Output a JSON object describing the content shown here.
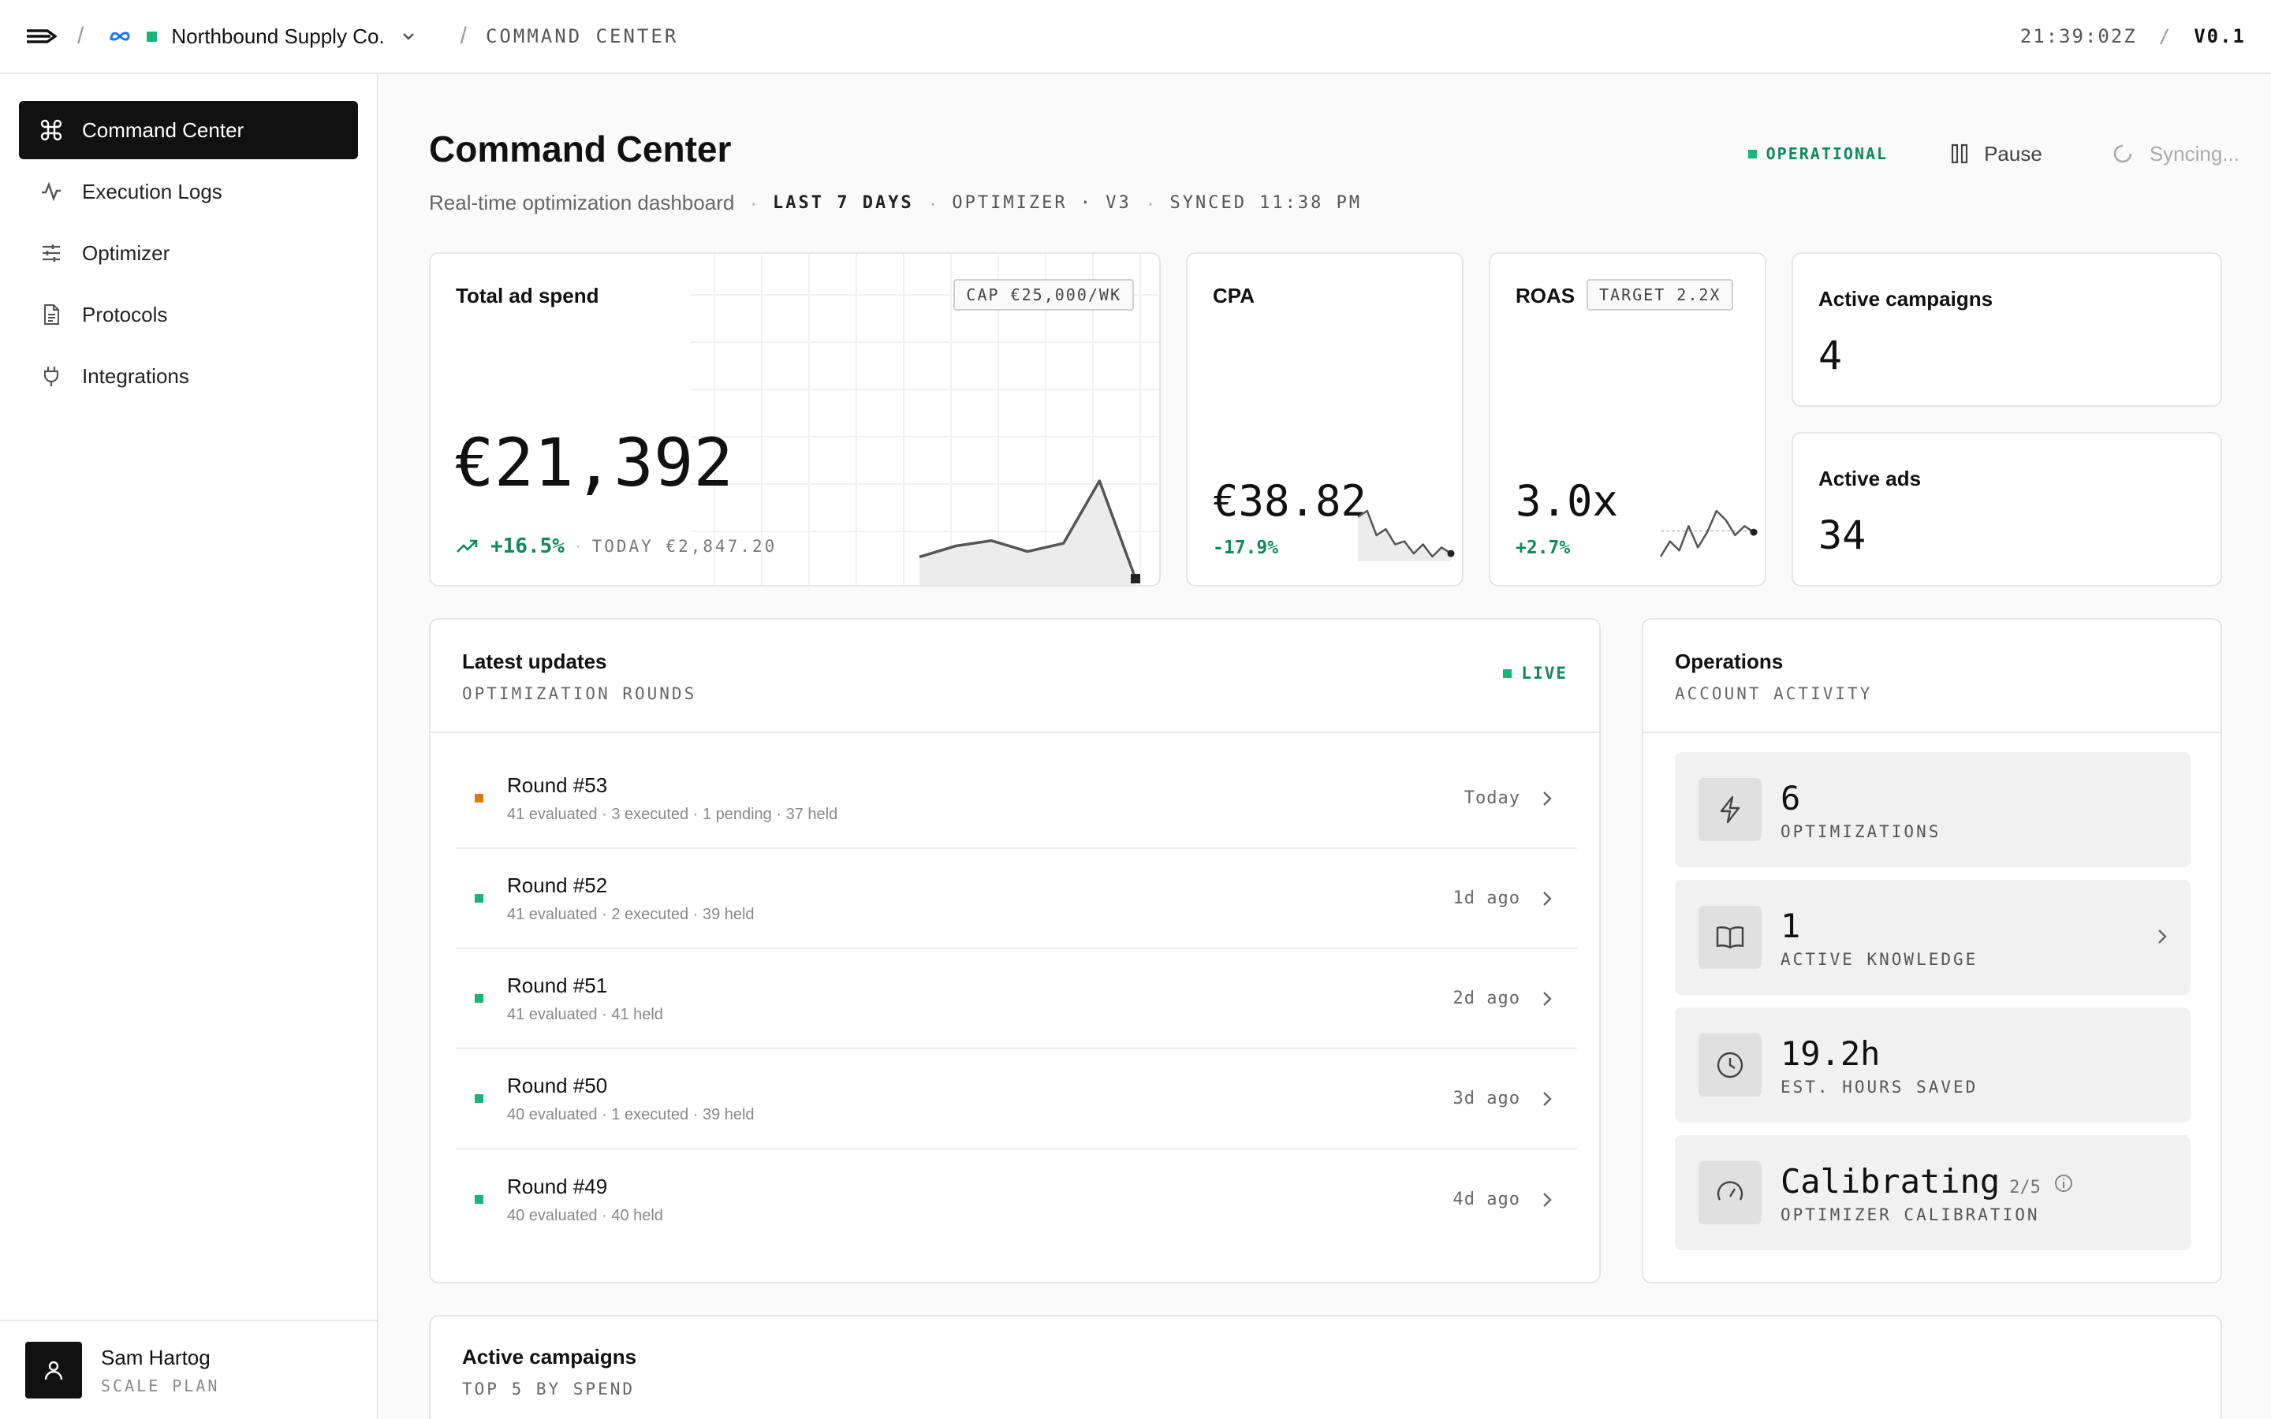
{
  "topbar": {
    "account": "Northbound Supply Co.",
    "section": "COMMAND CENTER",
    "time": "21:39:02Z",
    "version": "V0.1"
  },
  "sidebar": {
    "items": [
      {
        "label": "Command Center",
        "icon": "command-icon",
        "active": true
      },
      {
        "label": "Execution Logs",
        "icon": "activity-icon"
      },
      {
        "label": "Optimizer",
        "icon": "sliders-icon"
      },
      {
        "label": "Protocols",
        "icon": "document-icon"
      },
      {
        "label": "Integrations",
        "icon": "plug-icon"
      }
    ],
    "user": {
      "name": "Sam Hartog",
      "plan": "SCALE PLAN"
    }
  },
  "header": {
    "title": "Command Center",
    "subtitle": "Real-time optimization dashboard",
    "range": "LAST 7 DAYS",
    "optimizer": "OPTIMIZER · V3",
    "synced": "SYNCED 11:38 PM",
    "status": "OPERATIONAL",
    "pause_label": "Pause",
    "sync_label": "Syncing..."
  },
  "kpis": {
    "spend": {
      "title": "Total ad spend",
      "cap": "CAP €25,000/WK",
      "value": "€21,392",
      "delta": "+16.5%",
      "today": "TODAY €2,847.20"
    },
    "cpa": {
      "title": "CPA",
      "value": "€38.82",
      "delta": "-17.9%"
    },
    "roas": {
      "title": "ROAS",
      "target": "TARGET 2.2X",
      "value": "3.0x",
      "delta": "+2.7%"
    },
    "campaigns": {
      "title": "Active campaigns",
      "value": "4"
    },
    "ads": {
      "title": "Active ads",
      "value": "34"
    }
  },
  "updates": {
    "title": "Latest updates",
    "subtitle": "OPTIMIZATION ROUNDS",
    "live": "LIVE",
    "rounds": [
      {
        "name": "Round #53",
        "detail": "41 evaluated · 3 executed · 1 pending · 37 held",
        "time": "Today",
        "status_color": "#d97a14"
      },
      {
        "name": "Round #52",
        "detail": "41 evaluated · 2 executed · 39 held",
        "time": "1d ago",
        "status_color": "#17b57a"
      },
      {
        "name": "Round #51",
        "detail": "41 evaluated · 41 held",
        "time": "2d ago",
        "status_color": "#17b57a"
      },
      {
        "name": "Round #50",
        "detail": "40 evaluated · 1 executed · 39 held",
        "time": "3d ago",
        "status_color": "#17b57a"
      },
      {
        "name": "Round #49",
        "detail": "40 evaluated · 40 held",
        "time": "4d ago",
        "status_color": "#17b57a"
      }
    ]
  },
  "operations": {
    "title": "Operations",
    "subtitle": "ACCOUNT ACTIVITY",
    "items": [
      {
        "value": "6",
        "label": "OPTIMIZATIONS",
        "icon": "lightning-icon"
      },
      {
        "value": "1",
        "label": "ACTIVE KNOWLEDGE",
        "icon": "book-icon"
      },
      {
        "value": "19.2h",
        "label": "EST. HOURS SAVED",
        "icon": "clock-icon"
      },
      {
        "value": "Calibrating",
        "fraction": "2/5",
        "label": "OPTIMIZER CALIBRATION",
        "icon": "gauge-icon"
      }
    ]
  },
  "active_campaigns": {
    "title": "Active campaigns",
    "subtitle": "TOP 5 BY SPEND"
  },
  "sparklines": {
    "spend": [
      10,
      14,
      16,
      12,
      15,
      38,
      2
    ],
    "cpa": [
      22,
      24,
      16,
      18,
      13,
      14,
      10,
      13,
      9,
      12,
      10
    ],
    "roas": [
      10,
      15,
      12,
      20,
      13,
      18,
      25,
      22,
      17,
      20,
      18
    ]
  },
  "colors": {
    "accent": "#17b57a",
    "pending": "#d97a14",
    "positive": "#0f8a5a"
  }
}
